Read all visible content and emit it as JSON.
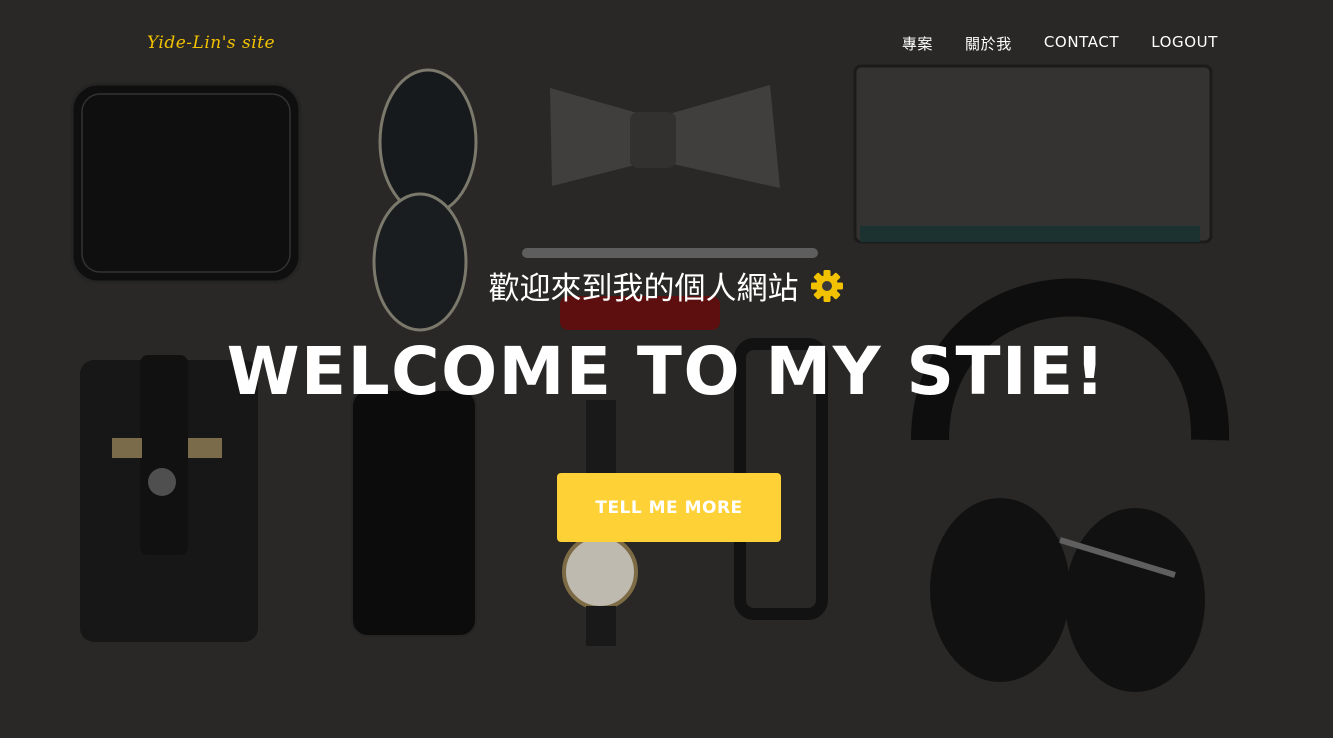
{
  "header": {
    "brand": "Yide-Lin's site",
    "nav": [
      {
        "label": "專案"
      },
      {
        "label": "關於我"
      },
      {
        "label": "CONTACT"
      },
      {
        "label": "LOGOUT"
      }
    ]
  },
  "hero": {
    "subtitle": "歡迎來到我的個人網站",
    "subtitle_icon": "gear-icon",
    "title": "WELCOME TO MY STIE!",
    "cta_label": "TELL ME MORE"
  },
  "colors": {
    "accent": "#fed136",
    "brand_text": "#f2c200",
    "background": "#2e2d2c",
    "text": "#ffffff"
  }
}
